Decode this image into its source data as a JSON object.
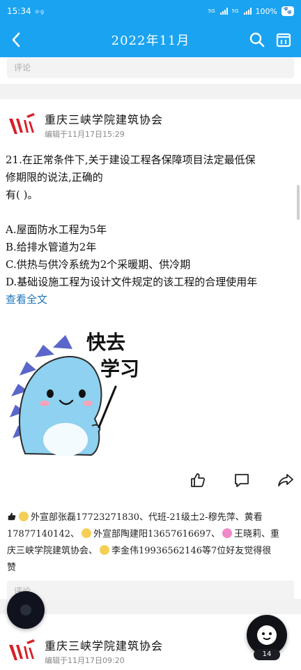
{
  "status": {
    "time": "15:34",
    "extra": "o·g",
    "sig1": "5G",
    "sig2": "5G",
    "battery": "100%"
  },
  "header": {
    "title": "2022年11月"
  },
  "prev_card": {
    "comment_placeholder": "评论"
  },
  "post": {
    "author": "重庆三峡学院建筑协会",
    "time": "编辑于11月17日15:29",
    "lines": [
      "21.在正常条件下,关于建设工程各保障项目法定最低保",
      "修期限的说法,正确的",
      "有( )。",
      "",
      "A.屋面防水工程为5年",
      "B.给排水管道为2年",
      "C.供热与供冷系统为2个采暖期、供冷期",
      "D.基础设施工程为设计文件规定的该工程的合理使用年"
    ],
    "more_label": "查看全文",
    "sticker_text_1": "快去",
    "sticker_text_2": "学习"
  },
  "likes": {
    "part1": "外宣部张磊17723271830、代班-21级土2-穆先萍、黄看",
    "part2": "17877140142、",
    "part3": "外宣部陶建阳13657616697、",
    "part4": "王晓莉、重",
    "part5": "庆三峡学院建筑协会、",
    "part6": "李金伟19936562146等7位好友觉得很",
    "part7": "赞"
  },
  "next_card": {
    "comment_placeholder": "评论",
    "author": "重庆三峡学院建筑协会",
    "time": "编辑于11月17日09:20"
  },
  "assistant": {
    "badge": "14"
  },
  "colors": {
    "accent": "#1aa3f0",
    "link": "#1f73b7",
    "logo_red": "#d8202a"
  }
}
